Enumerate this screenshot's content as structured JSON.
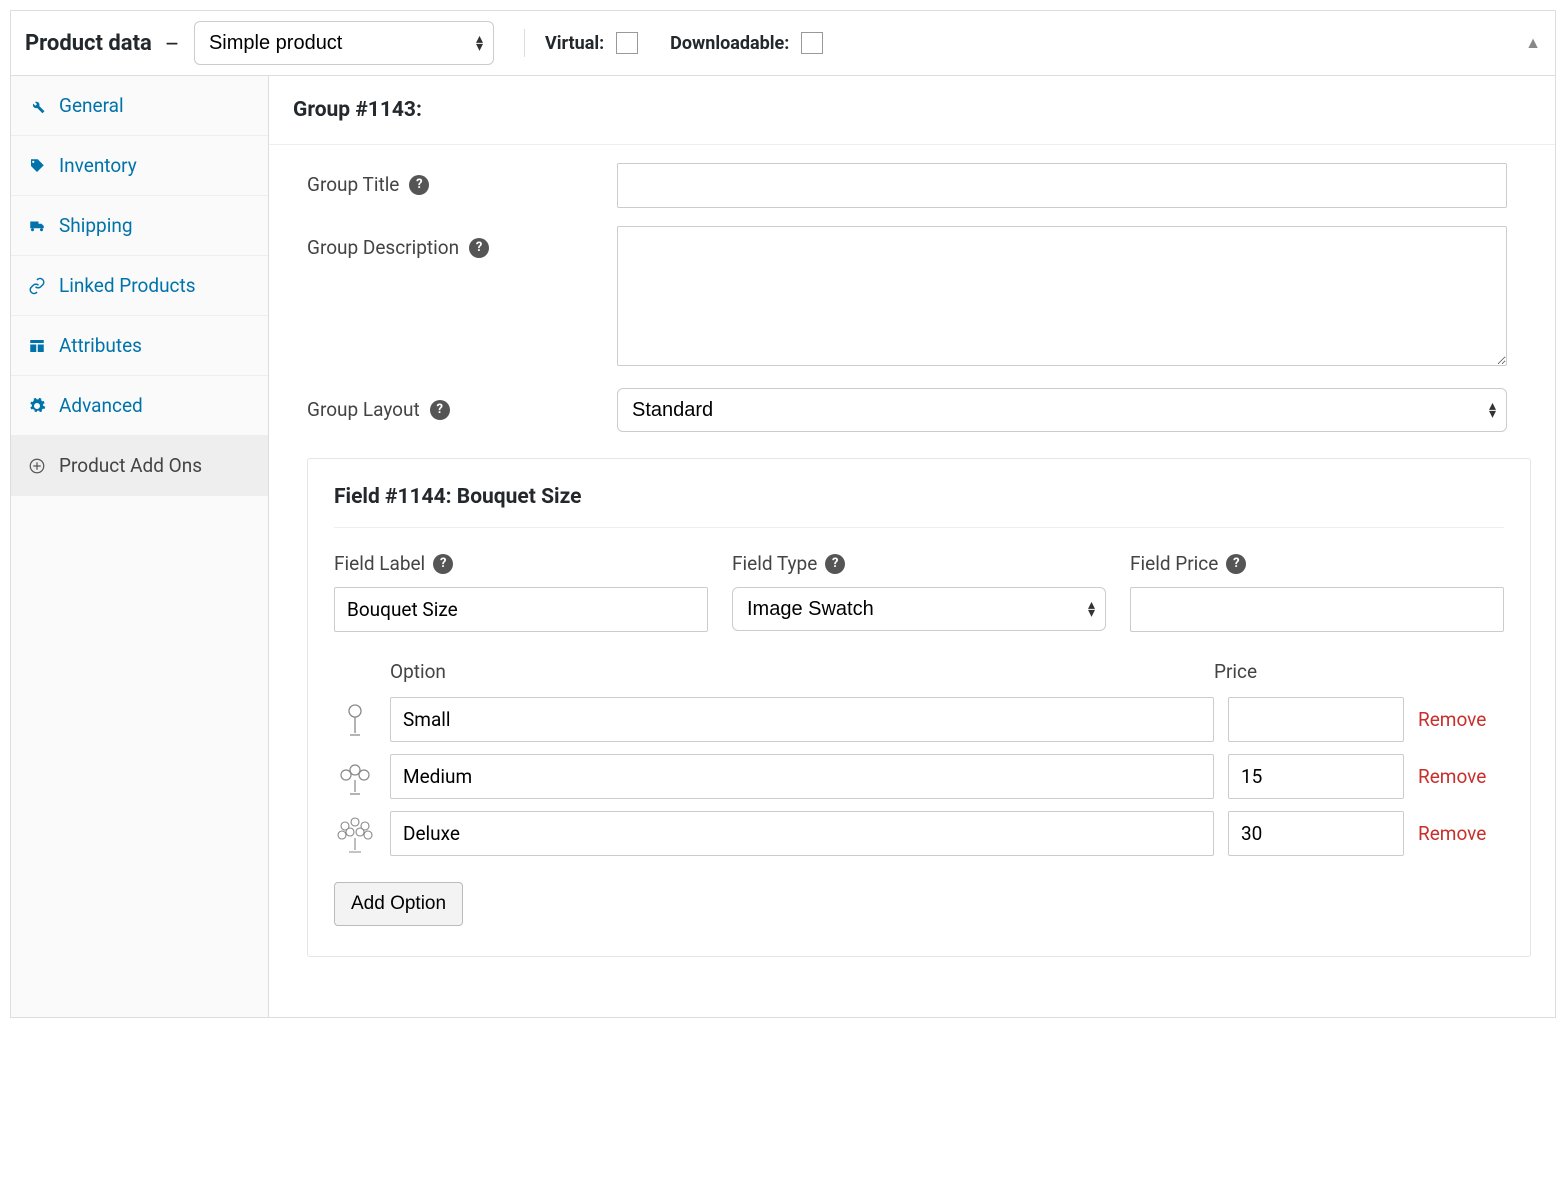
{
  "header": {
    "title": "Product data",
    "product_type": "Simple product",
    "virtual_label": "Virtual:",
    "downloadable_label": "Downloadable:"
  },
  "tabs": [
    {
      "icon": "wrench",
      "label": "General"
    },
    {
      "icon": "tag",
      "label": "Inventory"
    },
    {
      "icon": "truck",
      "label": "Shipping"
    },
    {
      "icon": "link",
      "label": "Linked Products"
    },
    {
      "icon": "layout",
      "label": "Attributes"
    },
    {
      "icon": "gear",
      "label": "Advanced"
    },
    {
      "icon": "plus-circle",
      "label": "Product Add Ons"
    }
  ],
  "group": {
    "heading": "Group #1143:",
    "title_label": "Group Title",
    "title_value": "",
    "desc_label": "Group Description",
    "desc_value": "",
    "layout_label": "Group Layout",
    "layout_value": "Standard"
  },
  "field": {
    "heading": "Field #1144: Bouquet Size",
    "label_label": "Field Label",
    "label_value": "Bouquet Size",
    "type_label": "Field Type",
    "type_value": "Image Swatch",
    "price_label": "Field Price",
    "price_value": ""
  },
  "options_header": {
    "option": "Option",
    "price": "Price"
  },
  "options": [
    {
      "name": "Small",
      "price": "",
      "remove": "Remove"
    },
    {
      "name": "Medium",
      "price": "15",
      "remove": "Remove"
    },
    {
      "name": "Deluxe",
      "price": "30",
      "remove": "Remove"
    }
  ],
  "buttons": {
    "add_option": "Add Option"
  }
}
